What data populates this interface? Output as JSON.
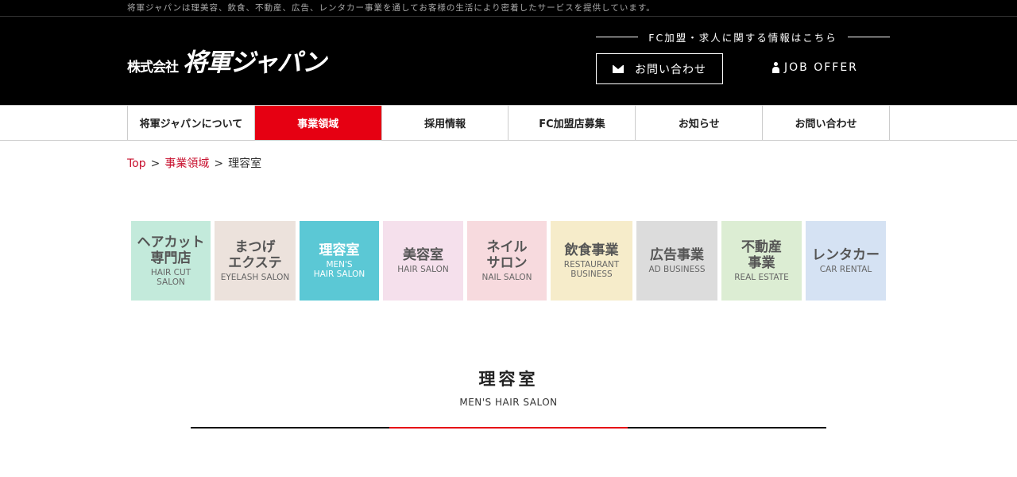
{
  "top_strip": "将軍ジャパンは理美容、飲食、不動産、広告、レンタカー事業を通してお客様の生活により密着したサービスを提供しています。",
  "logo": {
    "corp": "株式会社",
    "name": "将軍ジャパン"
  },
  "header": {
    "fc_info": "FC加盟・求人に関する情報はこちら",
    "contact_label": "お問い合わせ",
    "job_offer_label": "JOB OFFER"
  },
  "nav": [
    {
      "label": "将軍ジャパンについて",
      "active": false
    },
    {
      "label": "事業領域",
      "active": true
    },
    {
      "label": "採用情報",
      "active": false
    },
    {
      "label": "FC加盟店募集",
      "active": false
    },
    {
      "label": "お知らせ",
      "active": false
    },
    {
      "label": "お問い合わせ",
      "active": false
    }
  ],
  "breadcrumb": {
    "top": "Top",
    "sep": ">",
    "business": "事業領域",
    "current": "理容室"
  },
  "tiles": [
    {
      "jp1": "ヘアカット",
      "jp2": "専門店",
      "en1": "HAIR CUT",
      "en2": "SALON",
      "color": "#c3eadb"
    },
    {
      "jp1": "まつげ",
      "jp2": "エクステ",
      "en1": "EYELASH SALON",
      "en2": "",
      "color": "#ece2dc"
    },
    {
      "jp1": "理容室",
      "jp2": "",
      "en1": "MEN'S",
      "en2": "HAIR SALON",
      "color": "#5bc8d5",
      "active": true
    },
    {
      "jp1": "美容室",
      "jp2": "",
      "en1": "HAIR SALON",
      "en2": "",
      "color": "#f5e0ec"
    },
    {
      "jp1": "ネイル",
      "jp2": "サロン",
      "en1": "NAIL SALON",
      "en2": "",
      "color": "#f7dade"
    },
    {
      "jp1": "飲食事業",
      "jp2": "",
      "en1": "RESTAURANT",
      "en2": "BUSINESS",
      "color": "#f6ecca"
    },
    {
      "jp1": "広告事業",
      "jp2": "",
      "en1": "AD BUSINESS",
      "en2": "",
      "color": "#dcdcdc"
    },
    {
      "jp1": "不動産",
      "jp2": "事業",
      "en1": "REAL ESTATE",
      "en2": "",
      "color": "#dcedd3"
    },
    {
      "jp1": "レンタカー",
      "jp2": "",
      "en1": "CAR RENTAL",
      "en2": "",
      "color": "#d5e2f3"
    }
  ],
  "section": {
    "title": "理容室",
    "subtitle": "MEN'S HAIR SALON"
  },
  "colors": {
    "accent": "#e60012",
    "header_bg": "#000000",
    "link": "#c8102e"
  },
  "icons": {
    "contact": "mail-icon",
    "job_offer": "person-icon"
  }
}
